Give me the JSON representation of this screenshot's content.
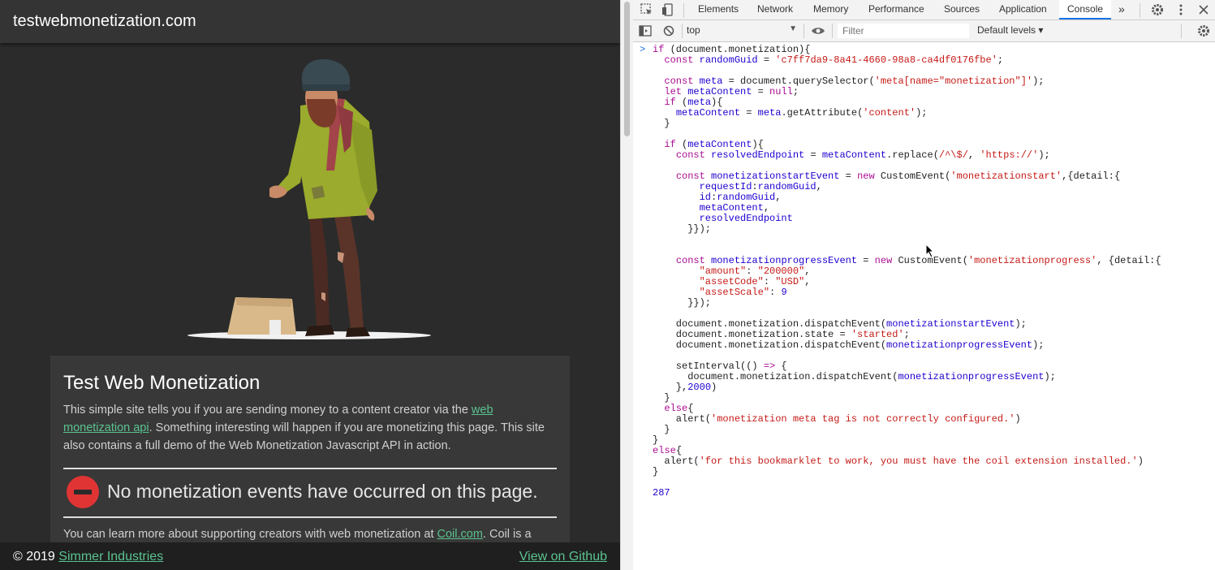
{
  "site": {
    "title": "testwebmonetization.com",
    "card": {
      "title": "Test Web Monetization",
      "intro_before_link": "This simple site tells you if you are sending money to a content creator via the ",
      "intro_link": "web monetization api",
      "intro_after_link": ". Something interesting will happen if you are monetizing this page. This site also contains a full demo of the Web Monetization Javascript API in action.",
      "status_text": "No monetization events have occurred on this page.",
      "more_before_link": "You can learn more about supporting creators with web monetization at ",
      "more_link": "Coil.com",
      "more_after_link": ". Coil is a"
    },
    "footer": {
      "copyright": "© 2019 ",
      "company_link": "Simmer Industries",
      "github_link": "View on Github"
    },
    "colors": {
      "background": "#2b2b2b",
      "link": "#5ac38f",
      "status_icon": "#e03434"
    }
  },
  "devtools": {
    "tabs": [
      "Elements",
      "Network",
      "Memory",
      "Performance",
      "Sources",
      "Application",
      "Console"
    ],
    "active_tab": "Console",
    "more_tabs_icon": "»",
    "context": "top",
    "filter_placeholder": "Filter",
    "levels": "Default levels ▾",
    "icons": [
      "inspect-icon",
      "device-icon",
      "sidebar-icon",
      "clear-icon",
      "eye-icon",
      "settings-icon",
      "more-icon",
      "close-icon"
    ],
    "console": {
      "lines": [
        "if (document.monetization){",
        "  const randomGuid = 'c7ff7da9-8a41-4660-98a8-ca4df0176fbe';",
        "",
        "  const meta = document.querySelector('meta[name=\"monetization\"]');",
        "  let metaContent = null;",
        "  if (meta){",
        "    metaContent = meta.getAttribute('content');",
        "  }",
        "",
        "  if (metaContent){",
        "    const resolvedEndpoint = metaContent.replace(/^\\$/, 'https://');",
        "",
        "    const monetizationstartEvent = new CustomEvent('monetizationstart',{detail:{",
        "        requestId:randomGuid,",
        "        id:randomGuid,",
        "        metaContent,",
        "        resolvedEndpoint",
        "      }});",
        "",
        "",
        "    const monetizationprogressEvent = new CustomEvent('monetizationprogress', {detail:{",
        "        \"amount\": \"200000\",",
        "        \"assetCode\": \"USD\",",
        "        \"assetScale\": 9",
        "      }});",
        "",
        "    document.monetization.dispatchEvent(monetizationstartEvent);",
        "    document.monetization.state = 'started';",
        "    document.monetization.dispatchEvent(monetizationprogressEvent);",
        "",
        "    setInterval(() => {",
        "      document.monetization.dispatchEvent(monetizationprogressEvent);",
        "    },2000)",
        "  }",
        "  else{",
        "    alert('monetization meta tag is not correctly configured.')",
        "  }",
        "}",
        "else{",
        "  alert('for this bookmarklet to work, you must have the coil extension installed.')",
        "}"
      ],
      "result": "287"
    }
  }
}
